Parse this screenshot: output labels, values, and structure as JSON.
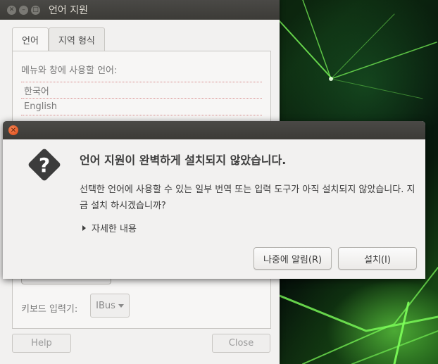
{
  "bg_window": {
    "title": "언어 지원",
    "tabs": [
      {
        "label": "언어",
        "active": true
      },
      {
        "label": "지역 형식",
        "active": false
      }
    ],
    "panel_label": "메뉴와 창에 사용할 언어:",
    "languages": [
      "한국어",
      "English"
    ],
    "keyboard_label": "키보드 입력기:",
    "keyboard_value": "IBus",
    "help_label": "Help",
    "close_label": "Close"
  },
  "dialog": {
    "heading": "언어 지원이 완벽하게 설치되지 않았습니다.",
    "body": "선택한 언어에 사용할 수 있는 일부 번역 또는 입력 도구가 아직 설치되지 않았습니다. 지금 설치 하시겠습니까?",
    "details_label": "자세한 내용",
    "later_label": "나중에 알림(R)",
    "install_label": "설치(I)"
  },
  "icons": {
    "question": "question-diamond-icon",
    "close": "close-icon"
  },
  "colors": {
    "titlebar": "#3c3b37",
    "close_button": "#df4a16",
    "window_bg": "#f2f1f0"
  }
}
